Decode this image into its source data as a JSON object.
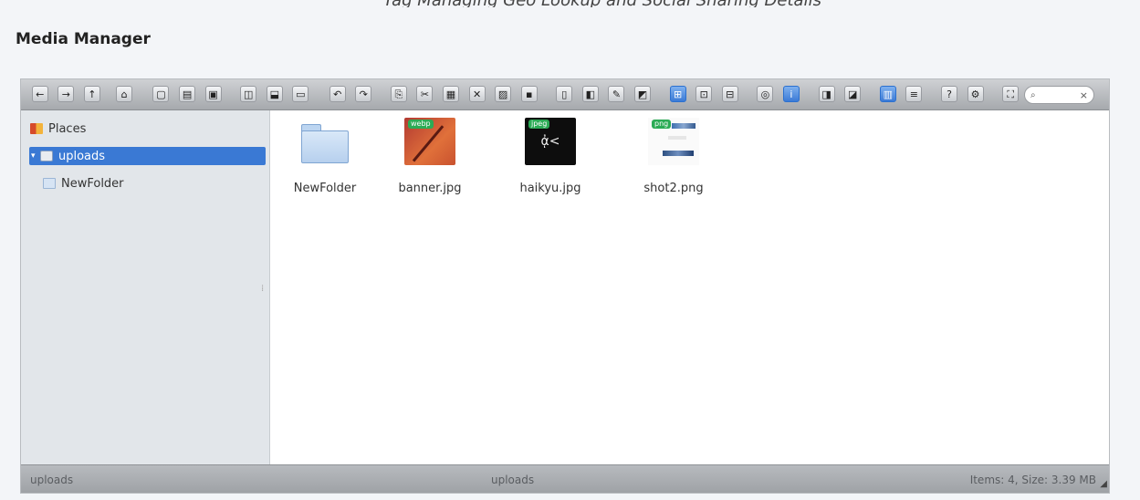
{
  "header": {
    "top_clipped_text": "Tag Managing Geo Lookup and Social Sharing Details",
    "title": "Media Manager"
  },
  "toolbar": {
    "buttons": [
      {
        "icon": "back-icon",
        "glyph": "←"
      },
      {
        "icon": "forward-icon",
        "glyph": "→"
      },
      {
        "icon": "up-icon",
        "glyph": "↑"
      },
      {
        "icon": "home-icon",
        "glyph": "⌂"
      },
      {
        "icon": "mkdir-icon",
        "glyph": "▢"
      },
      {
        "icon": "mkfile-icon",
        "glyph": "▤"
      },
      {
        "icon": "save-icon",
        "glyph": "▣"
      },
      {
        "icon": "open-icon",
        "glyph": "◫"
      },
      {
        "icon": "download-icon",
        "glyph": "⬓"
      },
      {
        "icon": "getfile-icon",
        "glyph": "▭"
      },
      {
        "icon": "undo-icon",
        "glyph": "↶"
      },
      {
        "icon": "redo-icon",
        "glyph": "↷"
      },
      {
        "icon": "copy-icon",
        "glyph": "⎘"
      },
      {
        "icon": "cut-icon",
        "glyph": "✂"
      },
      {
        "icon": "paste-icon",
        "glyph": "▦"
      },
      {
        "icon": "delete-icon",
        "glyph": "✕"
      },
      {
        "icon": "empty-icon",
        "glyph": "▨"
      },
      {
        "icon": "hide-icon",
        "glyph": "▪"
      },
      {
        "icon": "duplicate-icon",
        "glyph": "▯"
      },
      {
        "icon": "rename-icon",
        "glyph": "◧"
      },
      {
        "icon": "edit-icon",
        "glyph": "✎"
      },
      {
        "icon": "resize-icon",
        "glyph": "◩"
      },
      {
        "icon": "extract-icon",
        "glyph": "⊞"
      },
      {
        "icon": "archive-icon",
        "glyph": "⊡"
      },
      {
        "icon": "search-adv-icon",
        "glyph": "⊟"
      },
      {
        "icon": "chmod-icon",
        "glyph": "◎"
      },
      {
        "icon": "info-icon",
        "glyph": "i"
      },
      {
        "icon": "preview-icon",
        "glyph": "◨"
      },
      {
        "icon": "sort-icon",
        "glyph": "◪"
      },
      {
        "icon": "icons-view-icon",
        "glyph": "▥"
      },
      {
        "icon": "list-view-icon",
        "glyph": "≡"
      },
      {
        "icon": "help-icon",
        "glyph": "?"
      },
      {
        "icon": "preferences-icon",
        "glyph": "⚙"
      },
      {
        "icon": "fullscreen-icon",
        "glyph": "⛶"
      }
    ],
    "search_placeholder": "⌕",
    "search_clear": "×"
  },
  "sidebar": {
    "items": [
      {
        "label": "Places"
      },
      {
        "label": "uploads",
        "arrow": "▾"
      },
      {
        "label": "NewFolder"
      }
    ]
  },
  "files": [
    {
      "name": "NewFolder",
      "type": "folder"
    },
    {
      "name": "banner.jpg",
      "type": "image",
      "badge": "webp"
    },
    {
      "name": "haikyu.jpg",
      "type": "image",
      "badge": "jpeg",
      "thumb_text": "ᾀ<"
    },
    {
      "name": "shot2.png",
      "type": "image",
      "badge": "png"
    }
  ],
  "statusbar": {
    "left": "uploads",
    "center": "uploads",
    "right": "Items: 4, Size: 3.39 MB"
  },
  "colors": {
    "selection": "#3a79d4",
    "badge": "#2bab55"
  }
}
